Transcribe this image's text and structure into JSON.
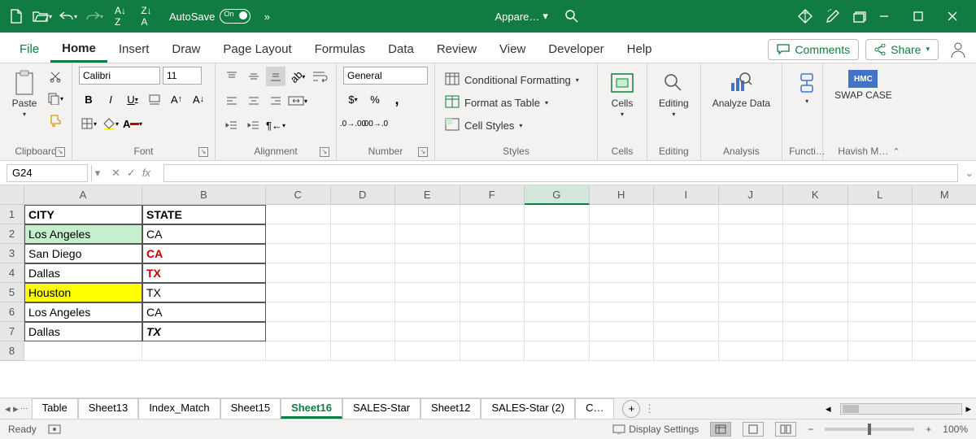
{
  "titlebar": {
    "autosave_label": "AutoSave",
    "autosave_state": "On",
    "doc_name": "Appare…",
    "more": "»"
  },
  "tabs": {
    "file": "File",
    "home": "Home",
    "insert": "Insert",
    "draw": "Draw",
    "page_layout": "Page Layout",
    "formulas": "Formulas",
    "data": "Data",
    "review": "Review",
    "view": "View",
    "developer": "Developer",
    "help": "Help",
    "comments": "Comments",
    "share": "Share"
  },
  "ribbon": {
    "clipboard": {
      "paste": "Paste",
      "label": "Clipboard"
    },
    "font": {
      "name": "Calibri",
      "size": "11",
      "label": "Font"
    },
    "alignment": {
      "label": "Alignment"
    },
    "number": {
      "format": "General",
      "label": "Number"
    },
    "styles": {
      "cond": "Conditional Formatting",
      "table": "Format as Table",
      "cell": "Cell Styles",
      "label": "Styles"
    },
    "cells": {
      "label": "Cells",
      "btn": "Cells"
    },
    "editing": {
      "label": "Editing",
      "btn": "Editing"
    },
    "analysis": {
      "label": "Analysis",
      "btn": "Analyze Data"
    },
    "functi": {
      "label": "Functi…"
    },
    "havish": {
      "label": "Havish M…",
      "btn": "SWAP CASE"
    }
  },
  "formula": {
    "namebox": "G24",
    "fx": "fx",
    "value": ""
  },
  "columns": [
    "A",
    "B",
    "C",
    "D",
    "E",
    "F",
    "G",
    "H",
    "I",
    "J",
    "K",
    "L",
    "M"
  ],
  "rows": [
    1,
    2,
    3,
    4,
    5,
    6,
    7,
    8
  ],
  "data_table": {
    "headers": {
      "city": "CITY",
      "state": "STATE"
    },
    "rows": [
      {
        "city": "Los Angeles",
        "state": "CA",
        "city_fill": "green",
        "state_style": ""
      },
      {
        "city": "San Diego",
        "state": "CA",
        "city_fill": "",
        "state_style": "red bold"
      },
      {
        "city": "Dallas",
        "state": "TX",
        "city_fill": "",
        "state_style": "red bold"
      },
      {
        "city": "Houston",
        "state": "TX",
        "city_fill": "yellow",
        "state_style": ""
      },
      {
        "city": "Los Angeles",
        "state": "CA",
        "city_fill": "",
        "state_style": ""
      },
      {
        "city": "Dallas",
        "state": "TX",
        "city_fill": "",
        "state_style": "bold italic"
      }
    ]
  },
  "selected_cell": "G24",
  "sheets": {
    "list": [
      "Table",
      "Sheet13",
      "Index_Match",
      "Sheet15",
      "Sheet16",
      "SALES-Star",
      "Sheet12",
      "SALES-Star (2)",
      "C…"
    ],
    "active": "Sheet16"
  },
  "status": {
    "ready": "Ready",
    "display": "Display Settings",
    "zoom": "100%"
  }
}
